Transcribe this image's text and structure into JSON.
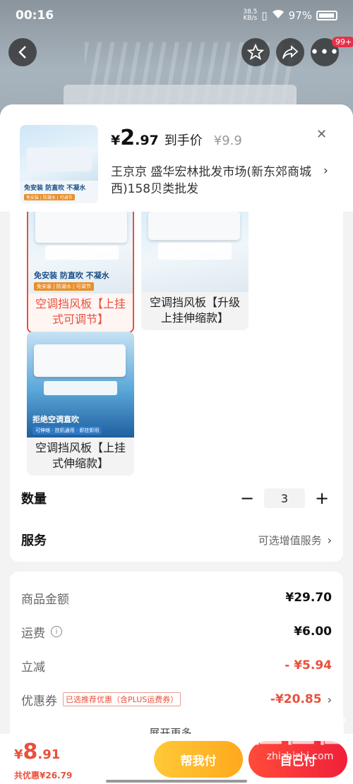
{
  "status_bar": {
    "time": "00:16",
    "speed_value": "38.5",
    "speed_unit": "KB/s",
    "battery": "97%"
  },
  "top_badge": "99+",
  "header": {
    "price_symbol": "¥",
    "price_int": "2",
    "price_dec": ".97",
    "price_label": "到手价",
    "original_price": "¥9.9",
    "shop": "王京京  盛华宏林批发市场(新东郊商城西)158贝类批发"
  },
  "variants": [
    {
      "label": "空调挡风板【上挂式可调节】",
      "tagline": "免安装 防直吹 不凝水",
      "chips": "免安装 | 防凝水 | 可调节"
    },
    {
      "label": "空调挡风板【升级上挂伸缩款】",
      "tagline": "",
      "chips": ""
    },
    {
      "label": "空调挡风板【上挂式伸缩款】",
      "tagline": "拒绝空调直吹",
      "chips": "可伸缩 · 挂机通用 · 即挂即用"
    }
  ],
  "quantity": {
    "title": "数量",
    "value": "3",
    "minus": "−",
    "plus": "+"
  },
  "service": {
    "title": "服务",
    "value": "可选增值服务"
  },
  "costs": {
    "goods": {
      "label": "商品金额",
      "value": "¥29.70"
    },
    "shipping": {
      "label": "运费",
      "value": "¥6.00"
    },
    "discount": {
      "label": "立减",
      "value": "- ¥5.94"
    },
    "coupon": {
      "label": "优惠券",
      "tag": "已选推荐优惠（含PLUS运费券）",
      "value": "-¥20.85"
    },
    "expand": "展开更多"
  },
  "bottom": {
    "total_symbol": "¥",
    "total_int": "8",
    "total_dec": ".91",
    "saved": "共优惠¥26.79",
    "help_pay": "帮我付",
    "self_pay": "自己付"
  },
  "watermark": {
    "big": "值值值",
    "small": "zhizhizhi.com"
  },
  "colors": {
    "accent_red": "#e8503c",
    "help_pay_yellow": "#ffb324",
    "self_pay_red": "#f0203a"
  }
}
